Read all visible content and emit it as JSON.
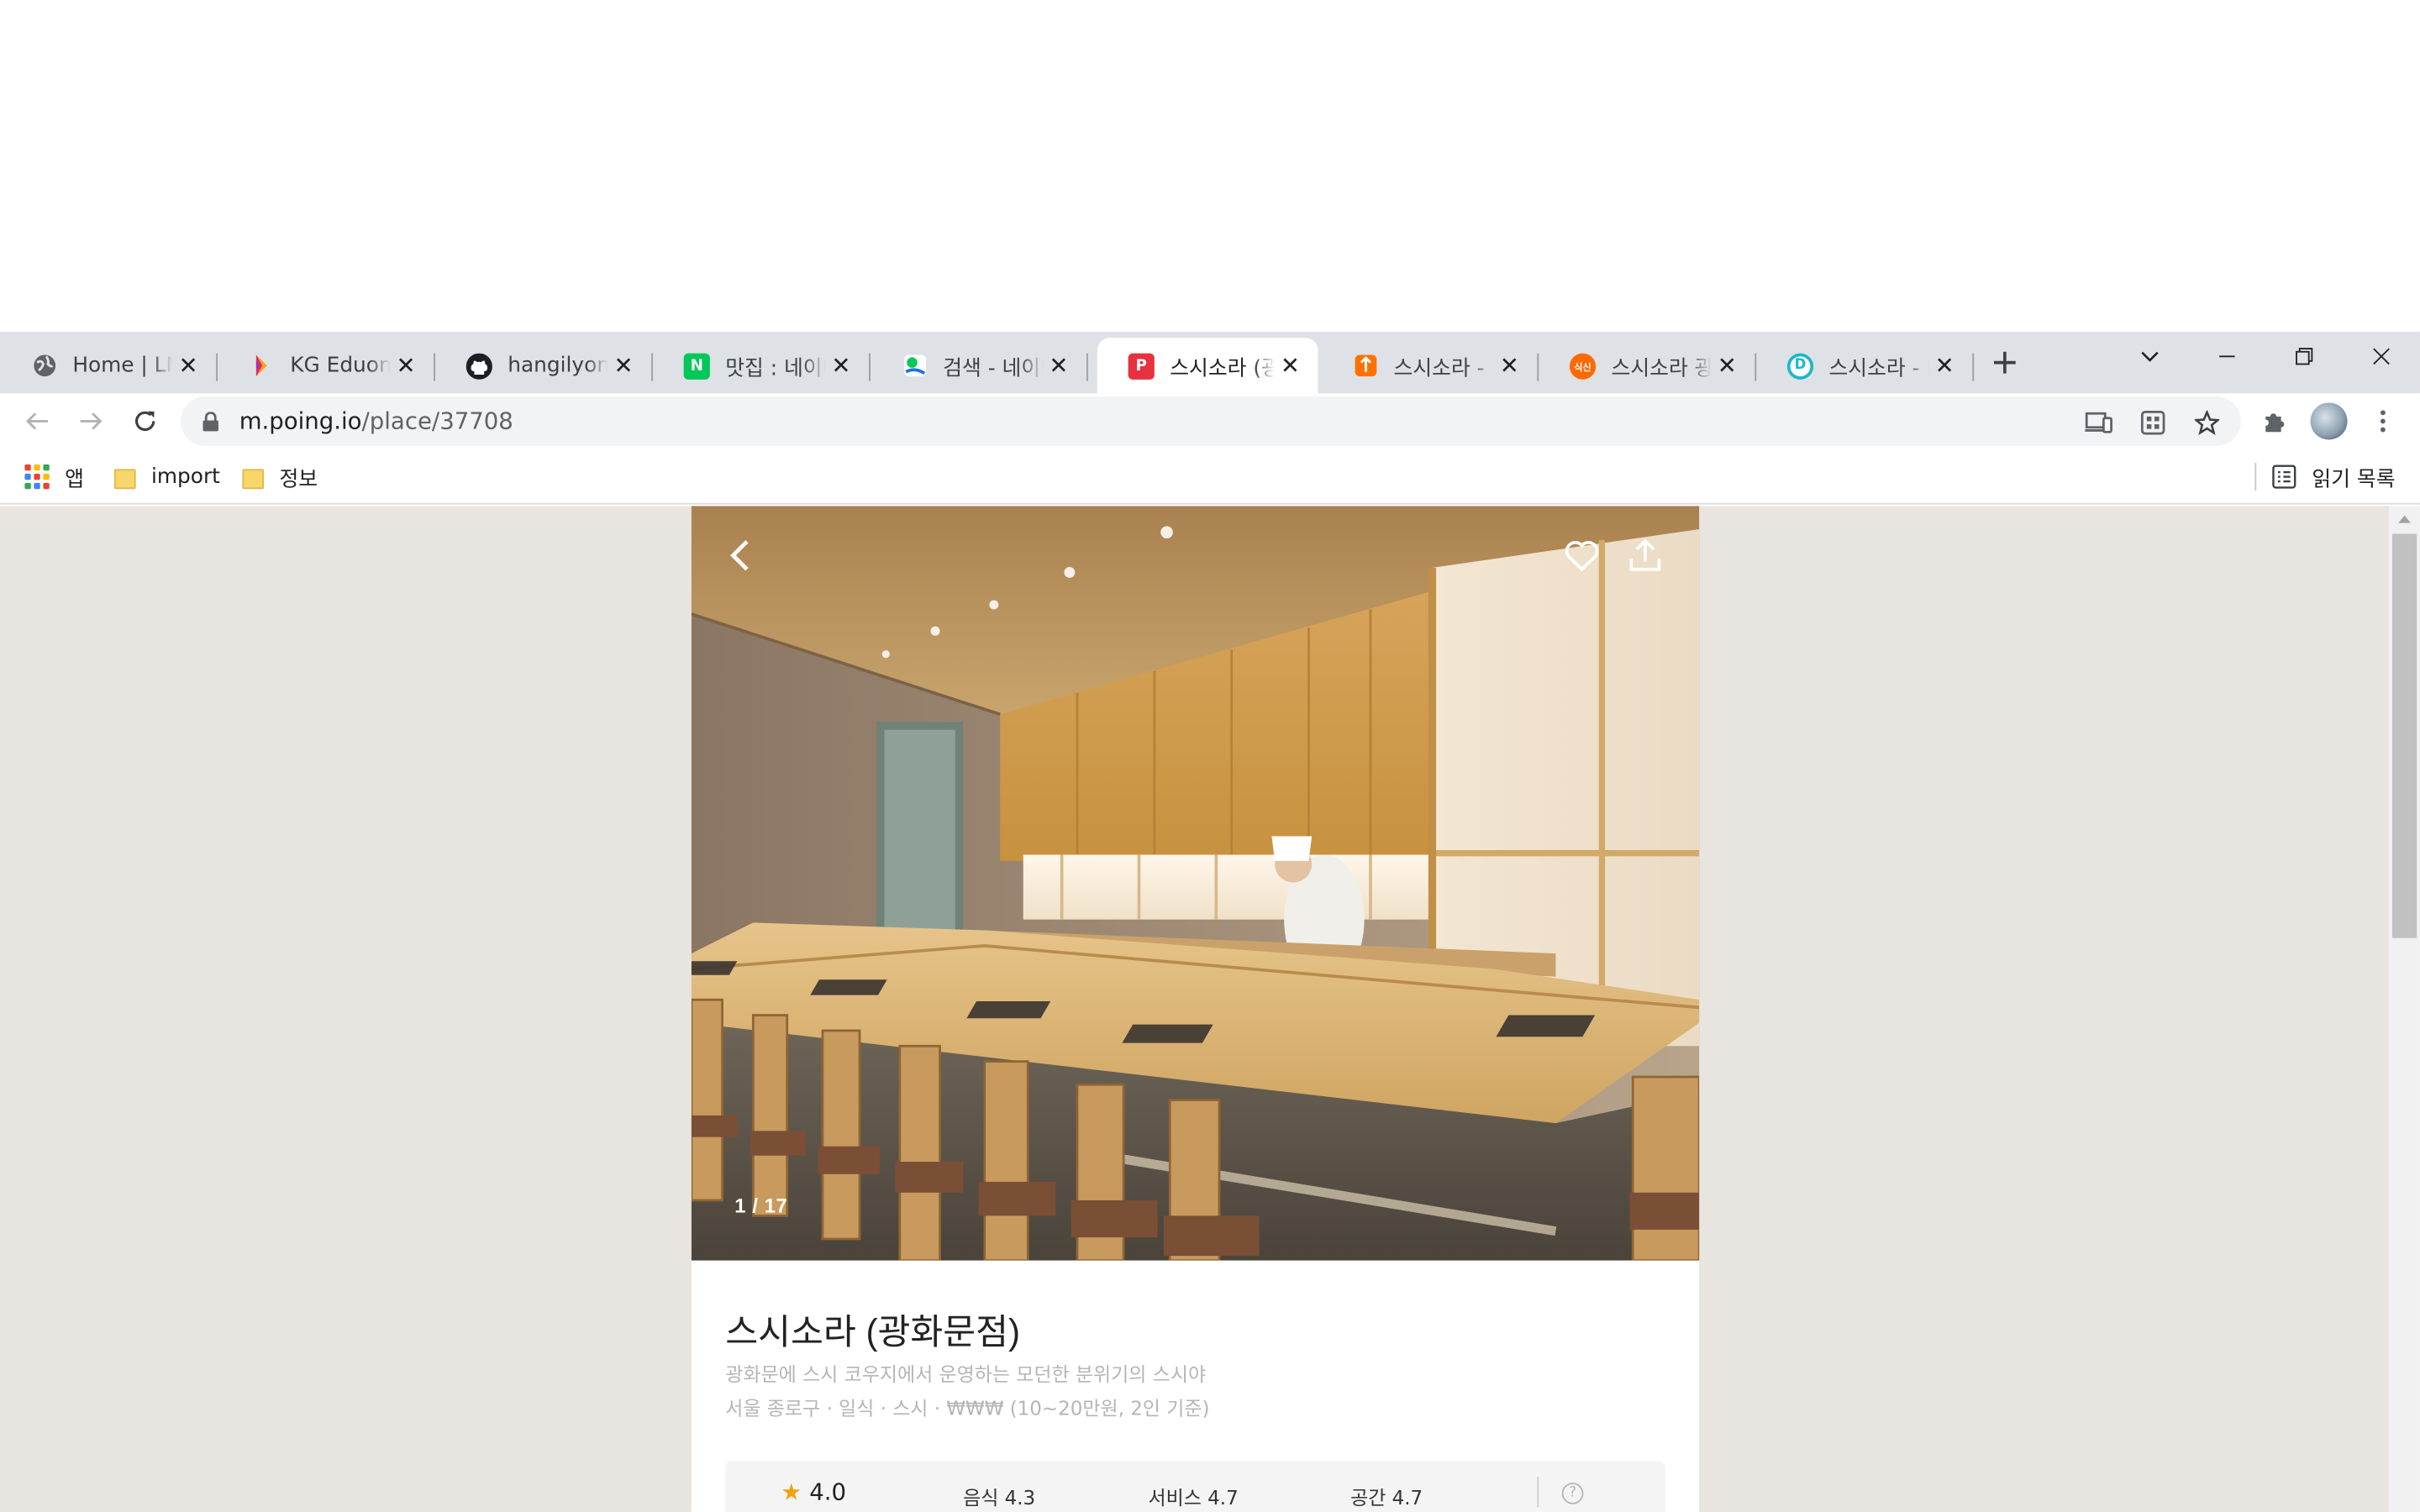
{
  "tabs": [
    {
      "label": "Home | LMS",
      "icon": "globe-icon"
    },
    {
      "label": "KG Eduone",
      "icon": "kg-eduone-icon"
    },
    {
      "label": "hangilyon/b",
      "icon": "github-icon"
    },
    {
      "label": "맛집 : 네이버",
      "icon": "naver-icon",
      "favicon_text": "N"
    },
    {
      "label": "검색 - 네이버",
      "icon": "naver-map-icon"
    },
    {
      "label": "스시소라 (광",
      "icon": "poing-icon",
      "favicon_text": "P",
      "active": true
    },
    {
      "label": "스시소라 - 식",
      "icon": "mangoplate-icon"
    },
    {
      "label": "스시소라 광",
      "icon": "siksin-icon",
      "favicon_text": "식신"
    },
    {
      "label": "스시소라 - 다",
      "icon": "diningcode-icon",
      "favicon_text": "D"
    }
  ],
  "toolbar": {
    "url_host": "m.poing.io",
    "url_path": "/place/37708"
  },
  "bookmarks": {
    "apps_label": "앱",
    "items": [
      "import",
      "정보"
    ],
    "reading_list_label": "읽기 목록"
  },
  "place": {
    "photo_counter": "1 / 17",
    "name": "스시소라 (광화문점)",
    "description": "광화문에 스시 코우지에서 운영하는 모던한 분위기의 스시야",
    "meta": "서울 종로구 · 일식 · 스시 · ₩₩₩ (10~20만원, 2인 기준)",
    "ratings": {
      "overall": "4.0",
      "food": "음식 4.3",
      "service": "서비스 4.7",
      "space": "공간 4.7"
    },
    "help_label": "?"
  },
  "colors": {
    "tabstrip": "#dee1e6",
    "page_background": "#e8e5e0",
    "star": "#f2a20a",
    "poing_red": "#e8313f",
    "naver_green": "#03c75a"
  }
}
